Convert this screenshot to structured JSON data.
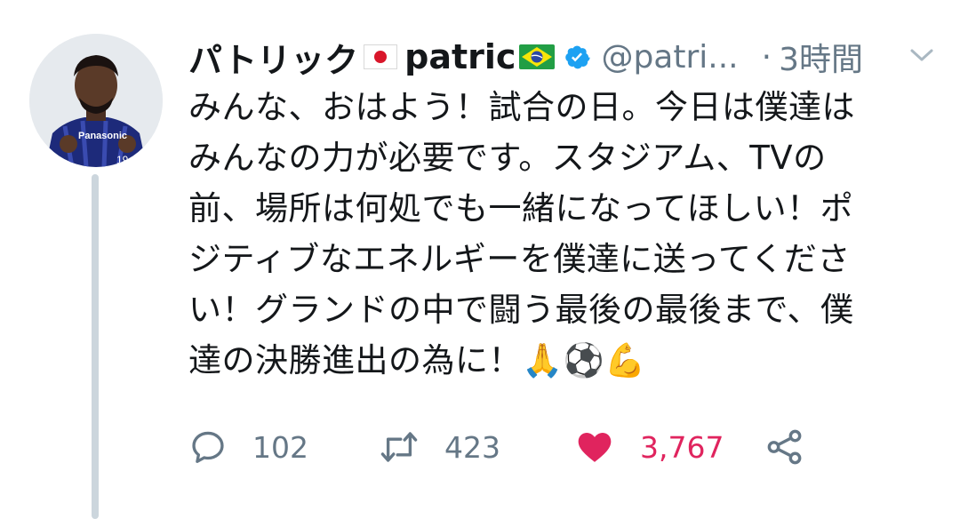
{
  "tweet": {
    "display_name": "パトリック",
    "display_name_2": "patric",
    "handle": "@patri...",
    "separator": "·",
    "time": "3時間",
    "text_lines": [
      "みんな、おはよう！試合の日。今日は僕達は",
      "みんなの力が必要です。スタジアム、TVの",
      "前、場所は何処でも一緒になってほしい！ポ",
      "ジティブなエネルギーを僕達に送ってくださ",
      "い！グランドの中で闘う最後の最後まで、僕",
      "達の決勝進出の為に！🙏⚽💪"
    ],
    "avatar_jersey_text": "Panasonic",
    "avatar_number": "19"
  },
  "actions": {
    "reply_count": "102",
    "retweet_count": "423",
    "like_count": "3,767"
  },
  "colors": {
    "text": "#14171a",
    "secondary": "#657786",
    "like": "#e0245e",
    "verified": "#1da1f2",
    "thread": "#ccd6dd"
  },
  "icons": {
    "reply": "reply-icon",
    "retweet": "retweet-icon",
    "like": "heart-icon",
    "share": "share-icon",
    "verified": "verified-badge-icon",
    "more": "chevron-down-icon"
  }
}
